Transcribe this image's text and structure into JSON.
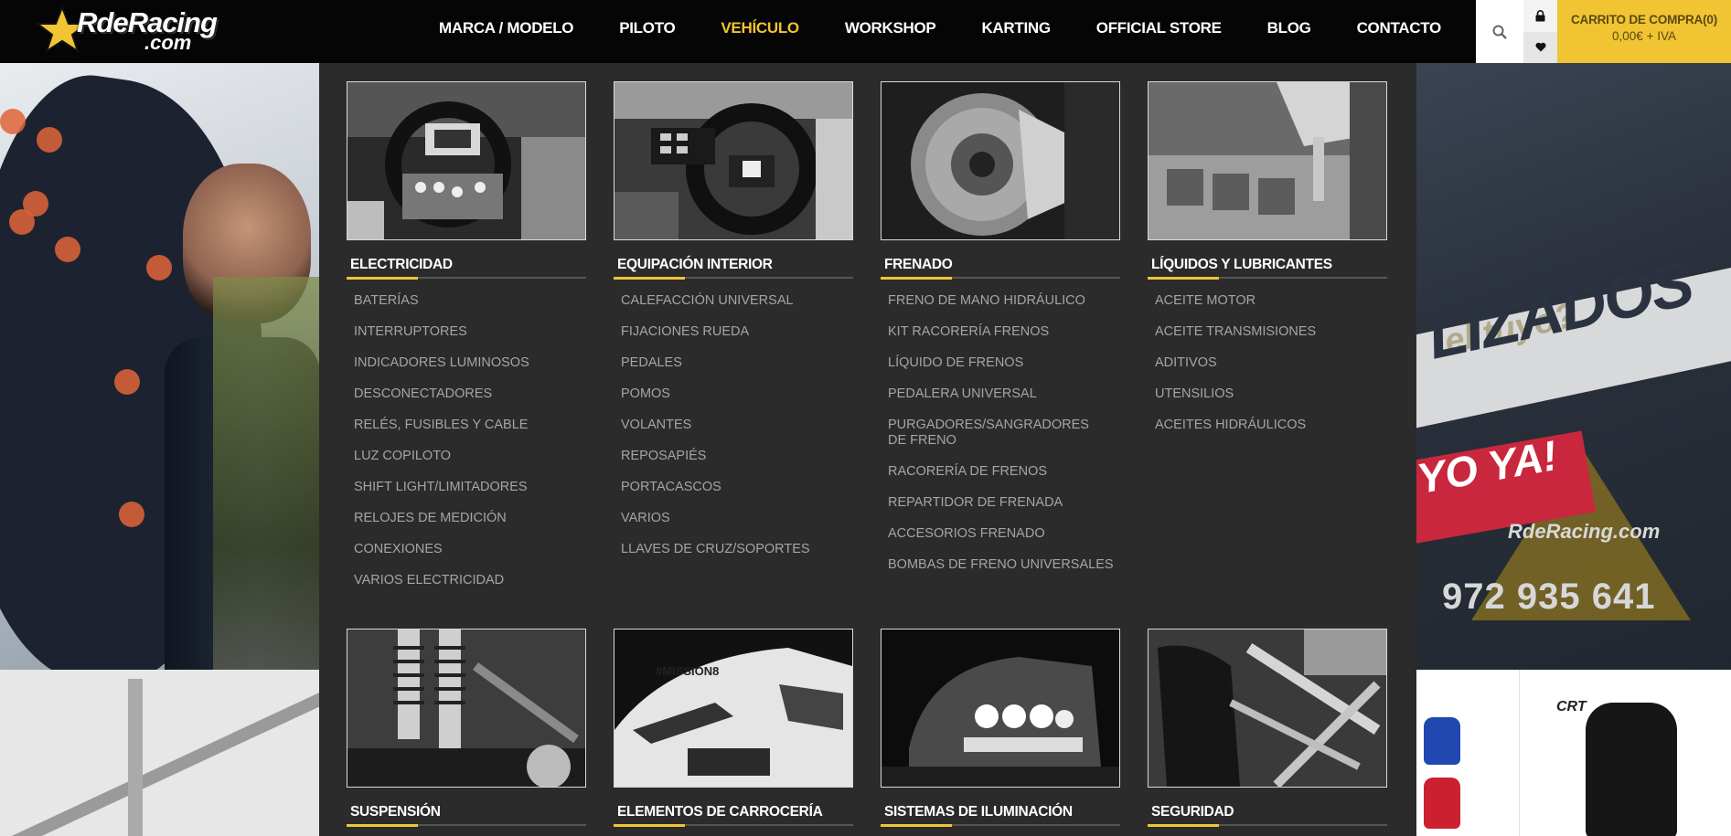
{
  "logo": {
    "text": "RdeRacing",
    "subtext": ".com"
  },
  "nav": {
    "items": [
      {
        "label": "MARCA / MODELO",
        "active": false
      },
      {
        "label": "PILOTO",
        "active": false
      },
      {
        "label": "VEHÍCULO",
        "active": true
      },
      {
        "label": "WORKSHOP",
        "active": false
      },
      {
        "label": "KARTING",
        "active": false
      },
      {
        "label": "OFFICIAL STORE",
        "active": false
      },
      {
        "label": "BLOG",
        "active": false
      },
      {
        "label": "CONTACTO",
        "active": false
      }
    ]
  },
  "header_actions": {
    "search_icon": "search-icon",
    "lock_icon": "lock-icon",
    "heart_icon": "heart-icon"
  },
  "cart": {
    "title": "CARRITO DE COMPRA(0)",
    "total": "0,00€ + IVA"
  },
  "colors": {
    "accent": "#f0c432",
    "menu_bg": "#2b2b2b",
    "header_bg": "#050505"
  },
  "mega_menu": {
    "categories": [
      {
        "title": "ELECTRICIDAD",
        "items": [
          "BATERÍAS",
          "INTERRUPTORES",
          "INDICADORES LUMINOSOS",
          "DESCONECTADORES",
          "RELÉS, FUSIBLES Y CABLE",
          "LUZ COPILOTO",
          "SHIFT LIGHT/LIMITADORES",
          "RELOJES DE MEDICIÓN",
          "CONEXIONES",
          "VARIOS ELECTRICIDAD"
        ]
      },
      {
        "title": "EQUIPACIÓN INTERIOR",
        "items": [
          "CALEFACCIÓN UNIVERSAL",
          "FIJACIONES RUEDA",
          "PEDALES",
          "POMOS",
          "VOLANTES",
          "REPOSAPIÉS",
          "PORTACASCOS",
          "VARIOS",
          "LLAVES DE CRUZ/SOPORTES"
        ]
      },
      {
        "title": "FRENADO",
        "items": [
          "FRENO DE MANO HIDRÁULICO",
          "KIT RACORERÍA FRENOS",
          "LÍQUIDO DE FRENOS",
          "PEDALERA UNIVERSAL",
          "PURGADORES/SANGRADORES DE FRENO",
          "RACORERÍA DE FRENOS",
          "REPARTIDOR DE FRENADA",
          "ACCESORIOS FRENADO",
          "BOMBAS DE FRENO UNIVERSALES"
        ]
      },
      {
        "title": "LÍQUIDOS Y LUBRICANTES",
        "items": [
          "ACEITE MOTOR",
          "ACEITE TRANSMISIONES",
          "ADITIVOS",
          "UTENSILIOS",
          "ACEITES HIDRÁULICOS"
        ]
      },
      {
        "title": "SUSPENSIÓN",
        "items": []
      },
      {
        "title": "ELEMENTOS DE CARROCERÍA",
        "items": []
      },
      {
        "title": "SISTEMAS DE ILUMINACIÓN",
        "items": []
      },
      {
        "title": "SEGURIDAD",
        "items": []
      }
    ]
  },
  "banner": {
    "line1": "LIZADOS",
    "line2": "YO YA!",
    "line3": "el tuyo?",
    "brand": "RdeRacing.com",
    "phone": "972 935 641"
  },
  "product_strip": {
    "brand": "CRT"
  }
}
